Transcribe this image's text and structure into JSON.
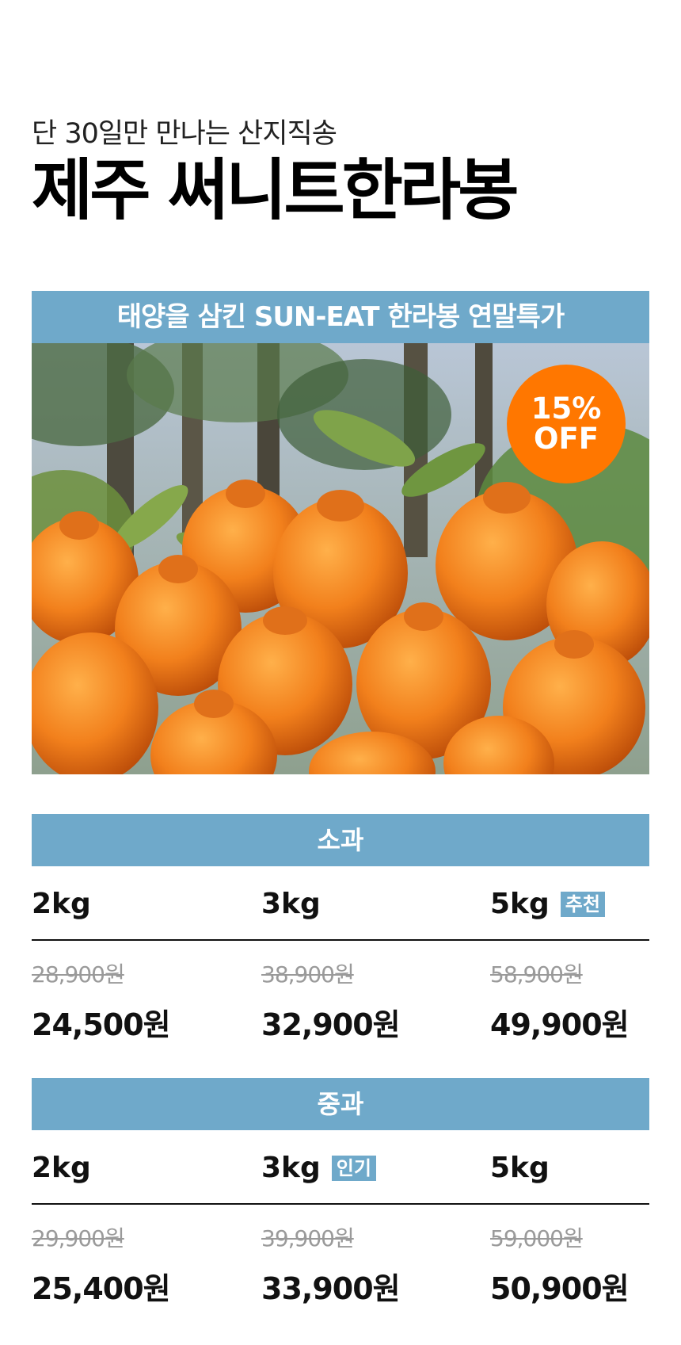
{
  "header": {
    "subtitle": "단 30일만 만나는 산지직송",
    "title": "제주 써니트한라봉"
  },
  "banner": {
    "text": "태양을 삼킨 SUN-EAT 한라봉 연말특가"
  },
  "badge": {
    "line1": "15%",
    "line2": "OFF",
    "color": "#FF7700"
  },
  "accent_color": "#6FA9CA",
  "sections": [
    {
      "label": "소과",
      "items": [
        {
          "weight": "2kg",
          "tag": "",
          "original_price": "28,900원",
          "sale_price": "24,500원"
        },
        {
          "weight": "3kg",
          "tag": "",
          "original_price": "38,900원",
          "sale_price": "32,900원"
        },
        {
          "weight": "5kg",
          "tag": "추천",
          "original_price": "58,900원",
          "sale_price": "49,900원"
        }
      ]
    },
    {
      "label": "중과",
      "items": [
        {
          "weight": "2kg",
          "tag": "",
          "original_price": "29,900원",
          "sale_price": "25,400원"
        },
        {
          "weight": "3kg",
          "tag": "인기",
          "original_price": "39,900원",
          "sale_price": "33,900원"
        },
        {
          "weight": "5kg",
          "tag": "",
          "original_price": "59,000원",
          "sale_price": "50,900원"
        }
      ]
    }
  ]
}
